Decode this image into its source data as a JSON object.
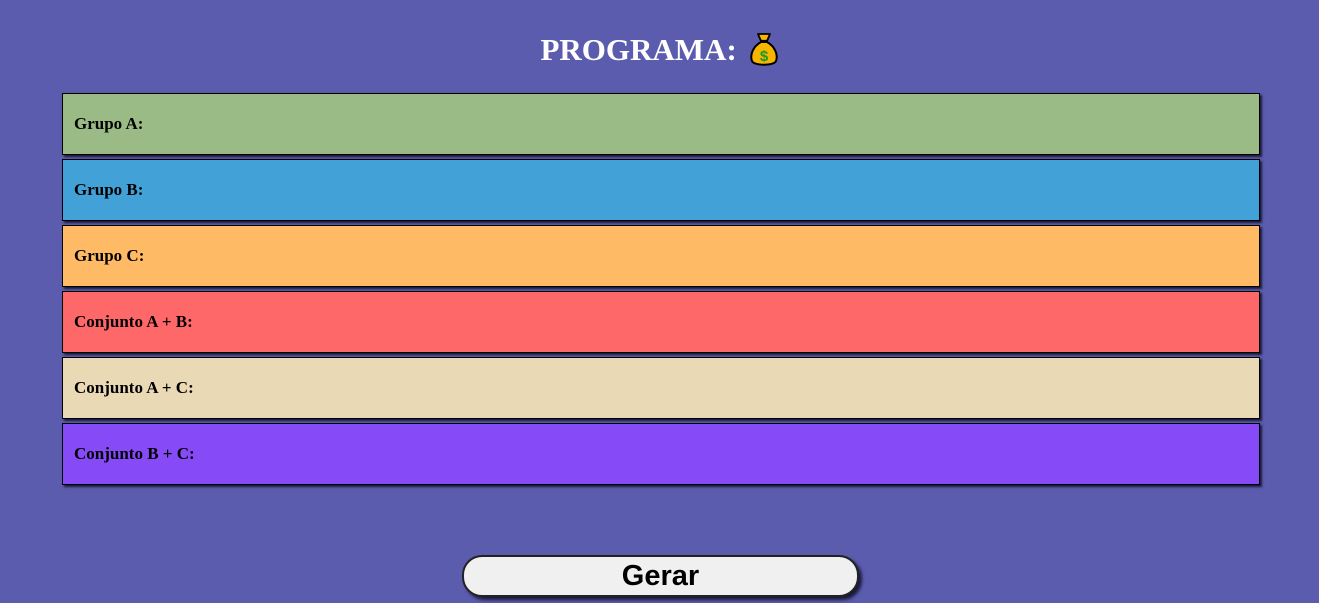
{
  "header": {
    "title": "PROGRAMA:",
    "icon": "money-bag-icon"
  },
  "groups": [
    {
      "label": "Grupo A:",
      "color": "#9abb86"
    },
    {
      "label": "Grupo B:",
      "color": "#42a1d7"
    },
    {
      "label": "Grupo C:",
      "color": "#ffba66"
    },
    {
      "label": "Conjunto A + B:",
      "color": "#ff6868"
    },
    {
      "label": "Conjunto A + C:",
      "color": "#ead9b5"
    },
    {
      "label": "Conjunto B + C:",
      "color": "#864af7"
    }
  ],
  "actions": {
    "generate_label": "Gerar"
  },
  "colors": {
    "background": "#5c5caf",
    "button": "#f0f0f0"
  }
}
